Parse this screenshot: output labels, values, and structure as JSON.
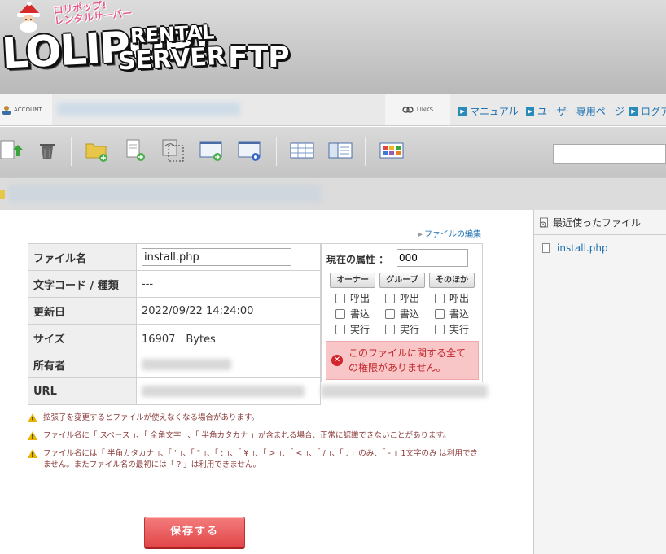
{
  "header": {
    "logo_sub": "ロリポップ!\nレンタルサーバー",
    "logo_main": "LOLIPOP!",
    "logo_rental": "RENTAL",
    "logo_server": "SERVER",
    "logo_ftp": "FTP"
  },
  "account_bar": {
    "account_label": "ACCOUNT",
    "links_label": "LINKS",
    "links": [
      "マニュアル",
      "ユーザー専用ページ",
      "ログア"
    ]
  },
  "toolbar": {
    "icons": [
      "upload-icon",
      "trash-icon",
      "new-folder-icon",
      "new-file-icon",
      "copy-icon",
      "move-icon",
      "properties-icon",
      "list-view-icon",
      "detail-view-icon",
      "thumbnail-view-icon"
    ]
  },
  "editor": {
    "edit_link": "ファイルの編集",
    "labels": {
      "filename": "ファイル名",
      "encoding": "文字コード / 種類",
      "updated": "更新日",
      "size": "サイズ",
      "owner": "所有者",
      "url": "URL"
    },
    "values": {
      "filename": "install.php",
      "encoding": "---",
      "updated": "2022/09/22 14:24:00",
      "size": "16907　Bytes"
    },
    "perm": {
      "title": "現在の属性 ：",
      "value": "000",
      "groups": [
        "オーナー",
        "グループ",
        "そのほか"
      ],
      "rights": [
        "呼出",
        "書込",
        "実行"
      ],
      "error": "このファイルに関する全ての権限がありません。"
    },
    "notes": [
      "拡張子を変更するとファイルが使えなくなる場合があります。",
      "ファイル名に「 スペース 」、「 全角文字 」、「 半角カタカナ 」が含まれる場合、正常に認識できないことがあります。",
      "ファイル名には「 半角カタカナ 」、「 ' 」、「 \" 」、「 : 」、「 ¥ 」、「 > 」、「 < 」、「 / 」、「 . 」のみ、「 - 」1文字のみ は利用できません。またファイル名の最初には「 ? 」は利用できません。"
    ],
    "save_label": "保存する"
  },
  "sidebar": {
    "title": "最近使ったファイル",
    "items": [
      "install.php"
    ]
  },
  "colors": {
    "link": "#1c6fb0",
    "save": "#e2474a",
    "error_bg": "#f8c6c6",
    "error_text": "#c0272d"
  }
}
